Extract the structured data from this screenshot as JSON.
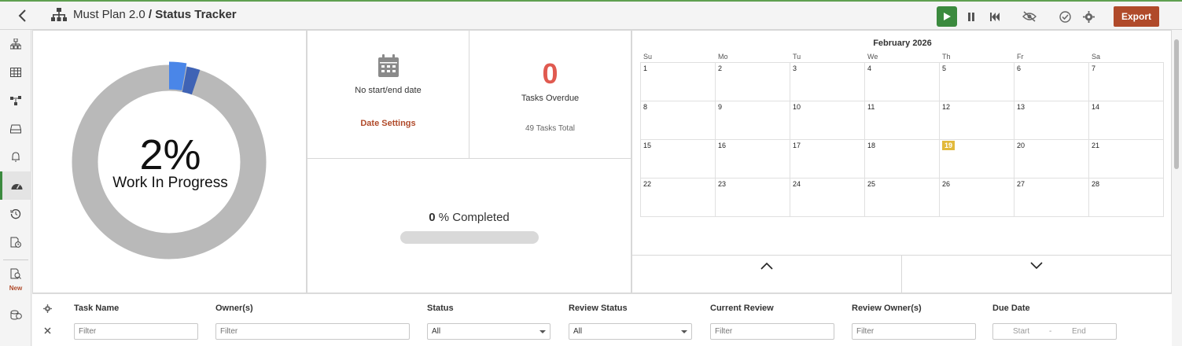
{
  "header": {
    "project": "Must Plan 2.0",
    "separator": " / ",
    "page": "Status Tracker",
    "export_label": "Export"
  },
  "sidebar": {
    "items": [
      "hierarchy-icon",
      "table-icon",
      "flow-icon",
      "inbox-icon",
      "bell-icon",
      "dashboard-icon",
      "history-icon",
      "doc-clock-icon",
      "doc-search-icon",
      "db-share-icon"
    ],
    "active": "dashboard-icon",
    "new_label": "New"
  },
  "summary": {
    "progress_percent": "2%",
    "progress_label": "Work In Progress",
    "no_date_label": "No start/end date",
    "date_settings_label": "Date Settings",
    "overdue_count": "0",
    "overdue_label": "Tasks Overdue",
    "total_label": "49 Tasks Total",
    "completed_value": "0",
    "completed_label": " % Completed",
    "completed_fraction": 0,
    "donut_segments": [
      {
        "fraction": 0.98,
        "color": "#b9b9b9"
      },
      {
        "fraction": 0.028,
        "color": "#4a86e8"
      },
      {
        "fraction": 0.022,
        "color": "#3f63b5"
      }
    ]
  },
  "calendar": {
    "month_title": "February 2026",
    "days_of_week": [
      "Su",
      "Mo",
      "Tu",
      "We",
      "Th",
      "Fr",
      "Sa"
    ],
    "weeks": [
      [
        "1",
        "2",
        "3",
        "4",
        "5",
        "6",
        "7"
      ],
      [
        "8",
        "9",
        "10",
        "11",
        "12",
        "13",
        "14"
      ],
      [
        "15",
        "16",
        "17",
        "18",
        "19",
        "20",
        "21"
      ],
      [
        "22",
        "23",
        "24",
        "25",
        "26",
        "27",
        "28"
      ]
    ],
    "today": "19"
  },
  "filters": {
    "columns": [
      {
        "label": "Task Name",
        "type": "text",
        "placeholder": "Filter"
      },
      {
        "label": "Owner(s)",
        "type": "text",
        "placeholder": "Filter"
      },
      {
        "label": "Status",
        "type": "select",
        "value": "All"
      },
      {
        "label": "Review Status",
        "type": "select",
        "value": "All"
      },
      {
        "label": "Current Review",
        "type": "text",
        "placeholder": "Filter"
      },
      {
        "label": "Review Owner(s)",
        "type": "text",
        "placeholder": "Filter"
      },
      {
        "label": "Due Date",
        "type": "range",
        "start": "Start",
        "dash": "-",
        "end": "End"
      }
    ]
  },
  "colors": {
    "accent_green": "#3b8a3e",
    "export_brown": "#b04a2a",
    "overdue_red": "#e05a50",
    "today_yellow": "#e2b93b"
  }
}
